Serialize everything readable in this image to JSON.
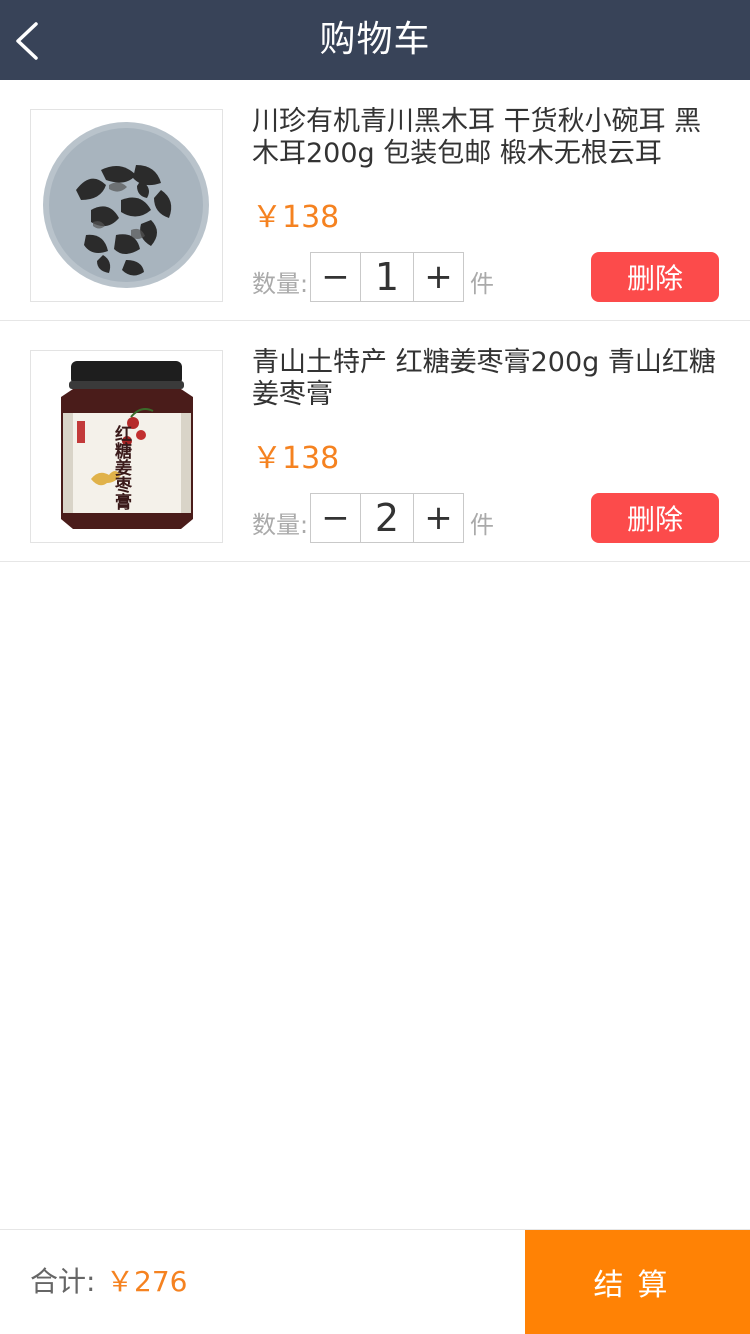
{
  "header": {
    "title": "购物车",
    "back_icon": "chevron-left-icon"
  },
  "items": [
    {
      "name": "川珍有机青川黑木耳 干货秋小碗耳 黑木耳200g 包装包邮 椴木无根云耳",
      "price": "￥138",
      "qty_label": "数量:",
      "minus": "−",
      "quantity": "1",
      "plus": "+",
      "unit": "件",
      "delete_label": "删除"
    },
    {
      "name": "青山土特产 红糖姜枣膏200g 青山红糖姜枣膏",
      "price": "￥138",
      "qty_label": "数量:",
      "minus": "−",
      "quantity": "2",
      "plus": "+",
      "unit": "件",
      "delete_label": "删除",
      "jar_label": "红糖姜枣膏"
    }
  ],
  "footer": {
    "total_label": "合计:",
    "total_price": "￥276",
    "checkout_label": "结算"
  },
  "colors": {
    "header_bg": "#384358",
    "price": "#f58220",
    "delete": "#fc4b4b",
    "checkout": "#ff8205"
  }
}
